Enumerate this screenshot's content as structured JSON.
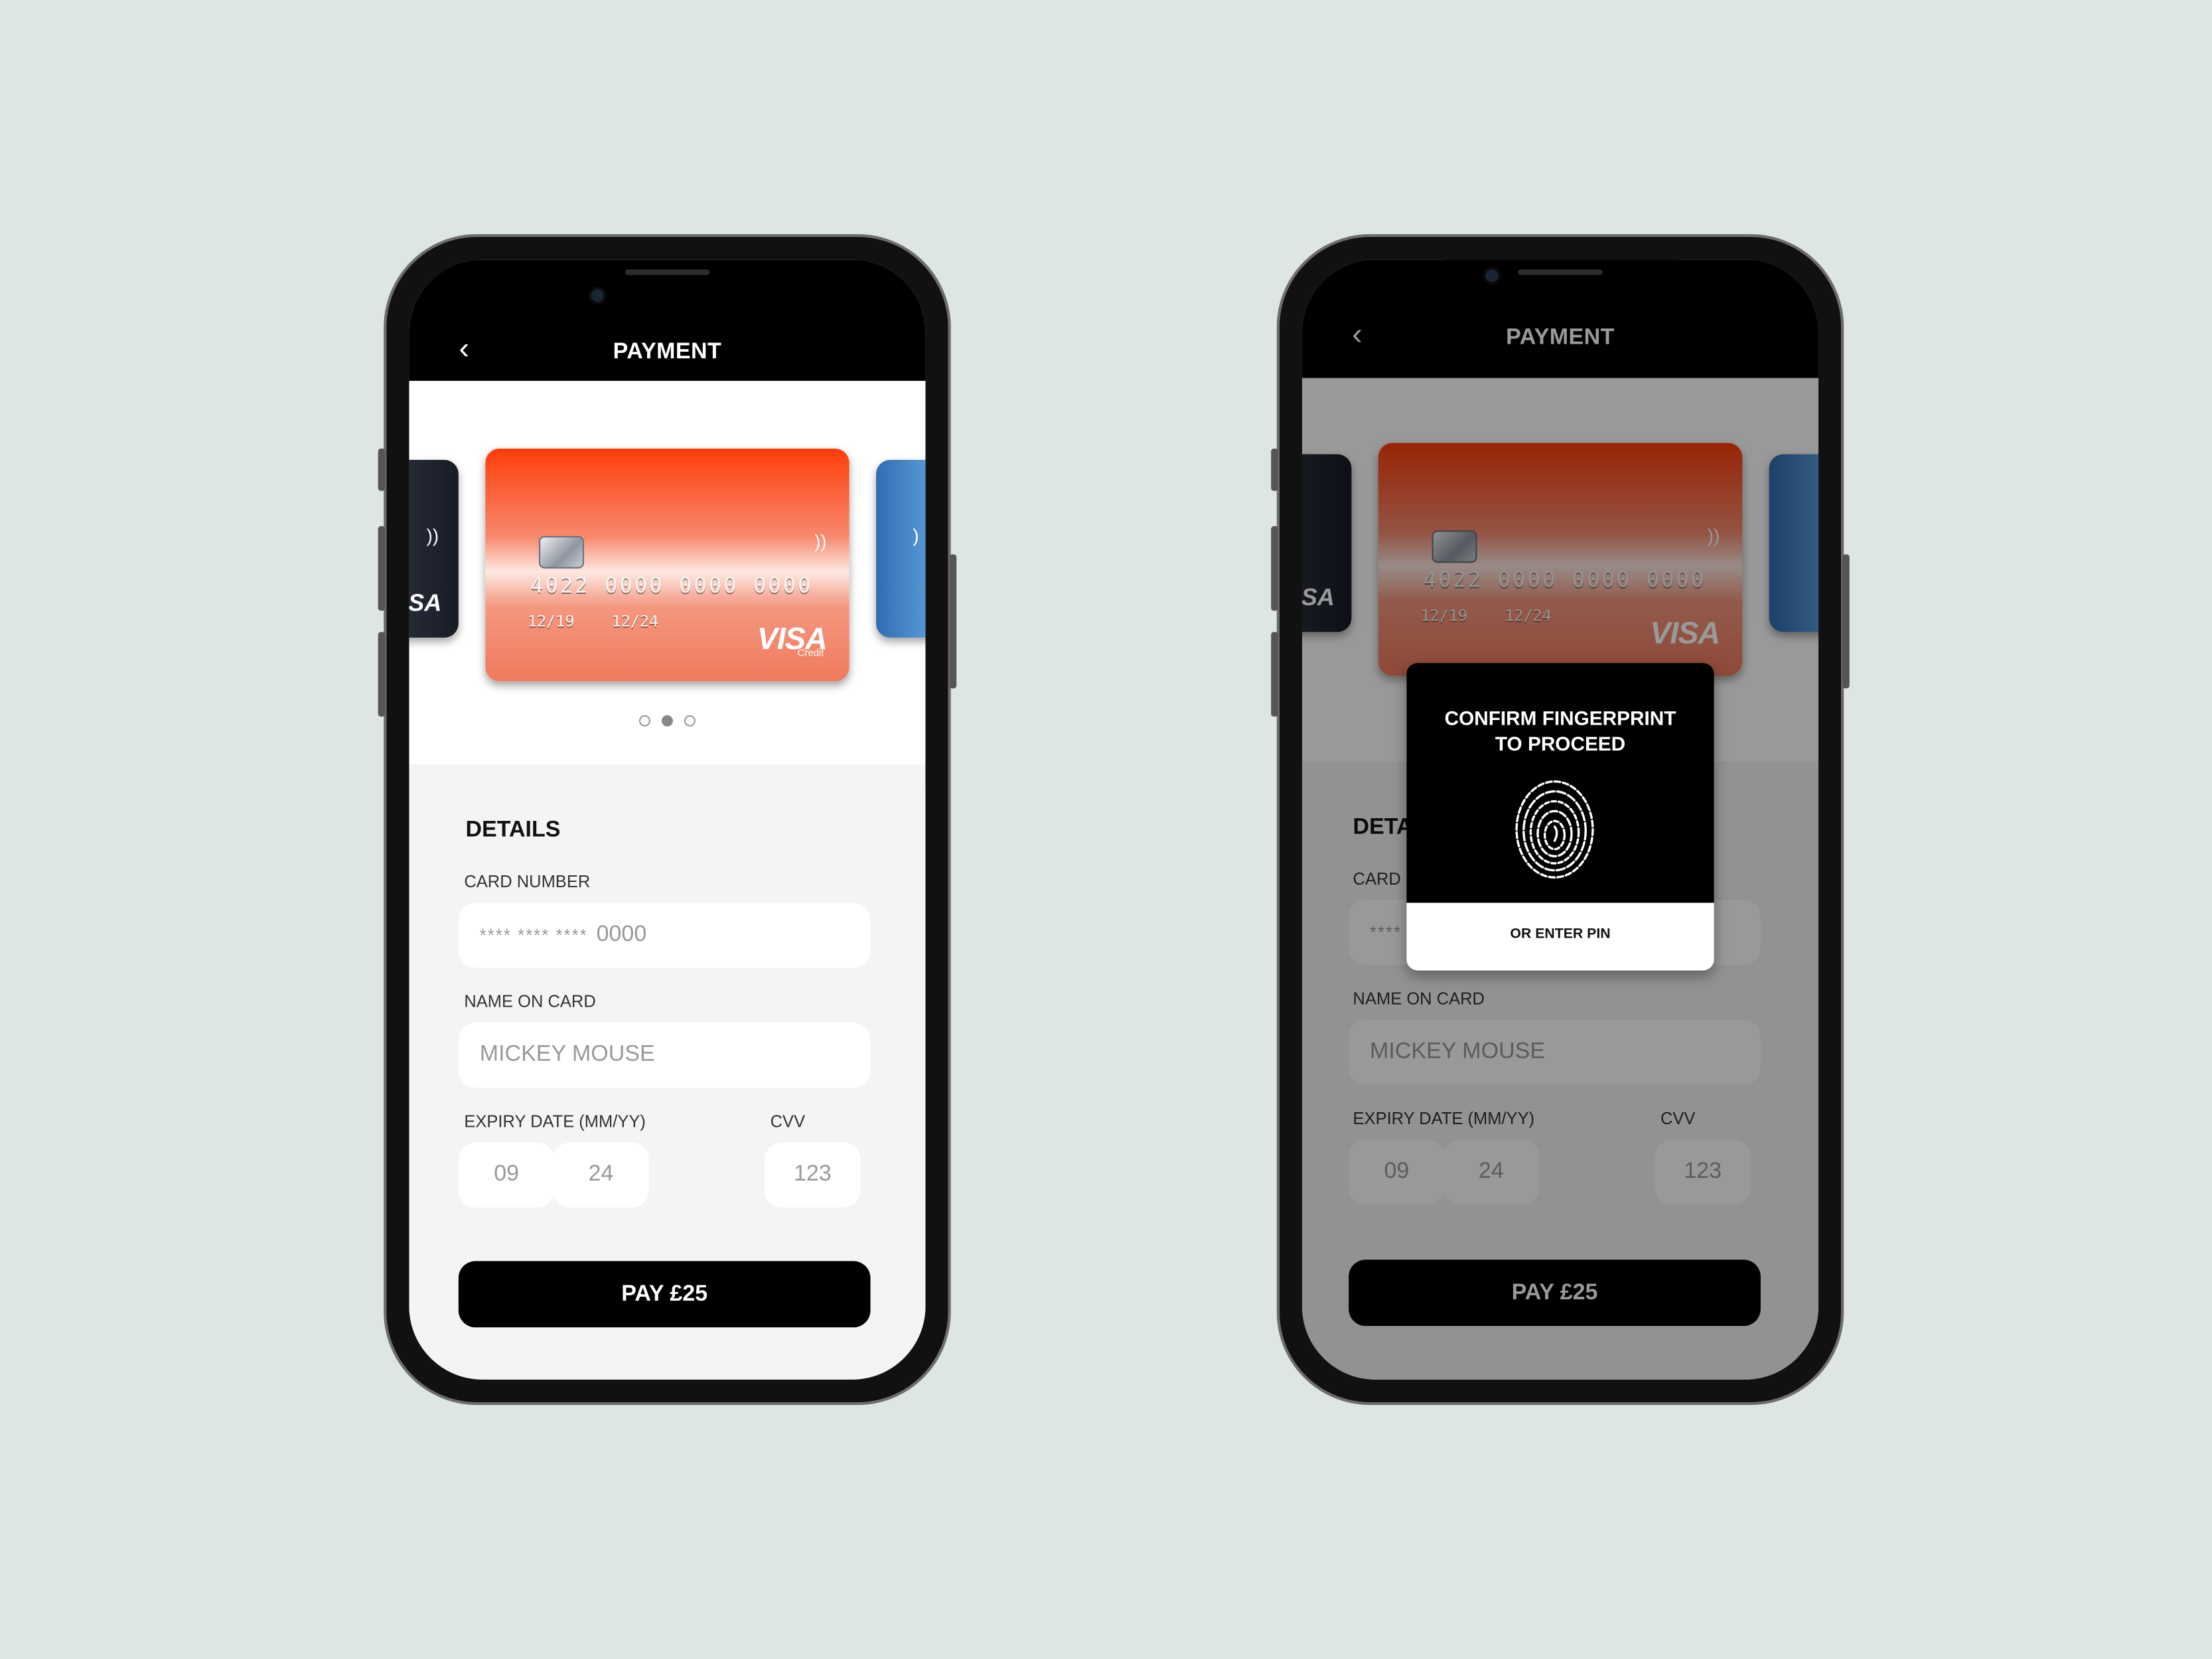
{
  "colors": {
    "background": "#dde6e5",
    "header": "#000000",
    "card_gradient_top": "#ff3d0a",
    "card_gradient_bottom": "#f07a5e",
    "pay_button": "#000000"
  },
  "screens": [
    {
      "header": {
        "back_icon": "chevron-left-icon",
        "title": "PAYMENT"
      },
      "card": {
        "number": "4022 0000 0000 0000",
        "valid_from": "12/19",
        "valid_thru": "12/24",
        "brand": "VISA",
        "brand_sub": "Credit",
        "peek_left_brand": "ISA",
        "peek_right_brand": ""
      },
      "carousel": {
        "count": 3,
        "active": 1
      },
      "details": {
        "title": "DETAILS",
        "card_number_label": "CARD NUMBER",
        "card_number_mask": "****  ****  ****",
        "card_number_last": "0000",
        "name_label": "NAME ON CARD",
        "name_value": "MICKEY MOUSE",
        "expiry_label": "EXPIRY DATE (MM/YY)",
        "expiry_month": "09",
        "expiry_year": "24",
        "cvv_label": "CVV",
        "cvv_value": "123"
      },
      "pay_button": "PAY £25"
    },
    {
      "header": {
        "back_icon": "chevron-left-icon",
        "title": "PAYMENT"
      },
      "card": {
        "number": "4022 0000 0000 0000",
        "valid_from": "12/19",
        "valid_thru": "12/24",
        "brand": "VISA",
        "peek_left_brand": "ISA"
      },
      "details": {
        "title": "DETAILS",
        "card_number_label": "CARD NUMBER",
        "card_number_mask": "****",
        "name_label": "NAME ON CARD",
        "name_value": "MICKEY MOUSE",
        "expiry_label": "EXPIRY DATE (MM/YY)",
        "expiry_month": "09",
        "expiry_year": "24",
        "cvv_label": "CVV",
        "cvv_value": "123"
      },
      "pay_button": "PAY £25",
      "modal": {
        "title_line1": "CONFIRM FINGERPRINT",
        "title_line2": "TO PROCEED",
        "icon": "fingerprint-icon",
        "alt_action": "OR ENTER PIN"
      }
    }
  ]
}
